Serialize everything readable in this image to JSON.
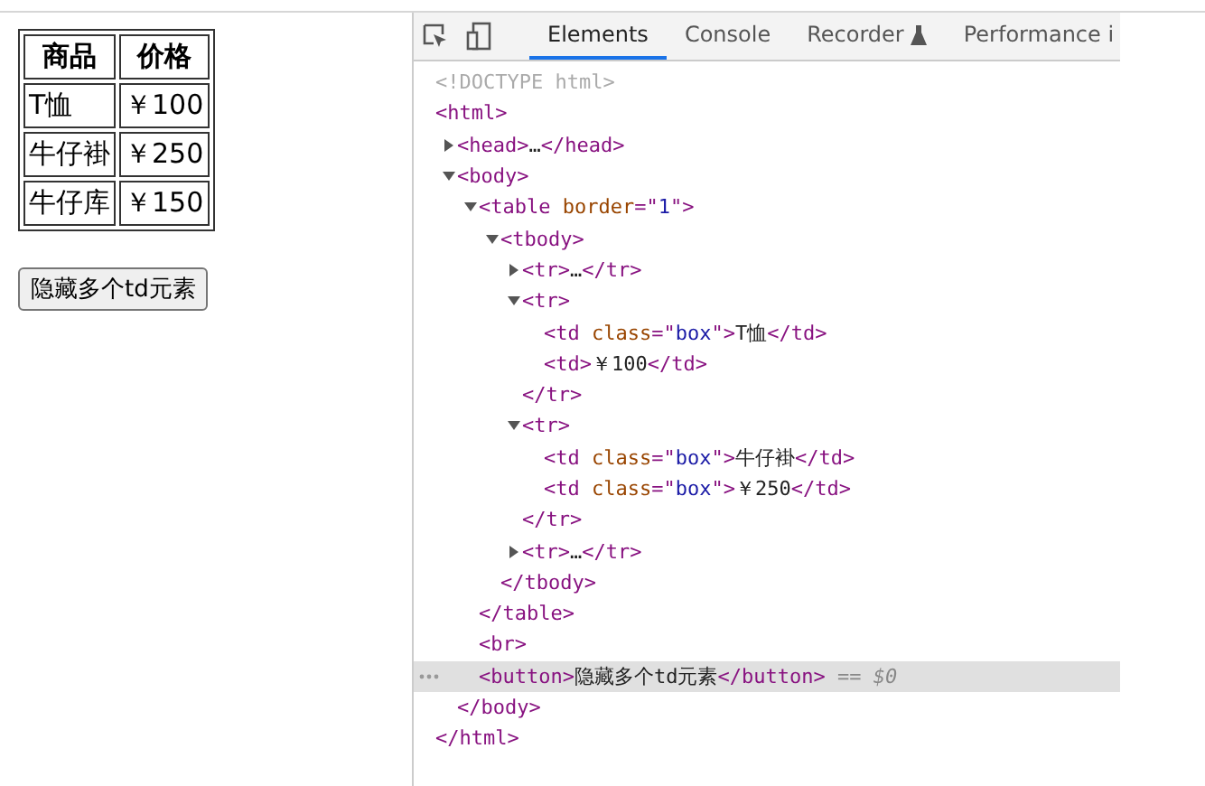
{
  "preview": {
    "table": {
      "columns": [
        "商品",
        "价格"
      ],
      "rows": [
        [
          "T恤",
          "￥100"
        ],
        [
          "牛仔褂",
          "￥250"
        ],
        [
          "牛仔库",
          "￥150"
        ]
      ]
    },
    "button": "隐藏多个td元素"
  },
  "devtools": {
    "tabs": [
      {
        "label": "Elements",
        "selected": true,
        "flask": false
      },
      {
        "label": "Console",
        "selected": false,
        "flask": false
      },
      {
        "label": "Recorder",
        "selected": false,
        "flask": true
      },
      {
        "label": "Performance i",
        "selected": false,
        "flask": false
      }
    ],
    "dom": [
      {
        "line": [
          {
            "kind": "doctype",
            "text": "<!DOCTYPE html>"
          }
        ]
      },
      {
        "line": [
          {
            "kind": "tag",
            "text": "<html>"
          }
        ],
        "close": [
          {
            "kind": "tag",
            "text": "</html>"
          }
        ],
        "children": [
          {
            "expanded": false,
            "line": [
              {
                "kind": "tag",
                "text": "<head>"
              },
              {
                "kind": "text",
                "text": "…"
              },
              {
                "kind": "tag",
                "text": "</head>"
              }
            ]
          },
          {
            "expanded": true,
            "line": [
              {
                "kind": "tag",
                "text": "<body>"
              }
            ],
            "close": [
              {
                "kind": "tag",
                "text": "</body>"
              }
            ],
            "children": [
              {
                "expanded": true,
                "line": [
                  {
                    "kind": "tag",
                    "text": "<table"
                  },
                  {
                    "kind": "attr",
                    "text": " border"
                  },
                  {
                    "kind": "tag",
                    "text": "=\""
                  },
                  {
                    "kind": "value",
                    "text": "1"
                  },
                  {
                    "kind": "tag",
                    "text": "\">"
                  }
                ],
                "close": [
                  {
                    "kind": "tag",
                    "text": "</table>"
                  }
                ],
                "children": [
                  {
                    "expanded": true,
                    "line": [
                      {
                        "kind": "tag",
                        "text": "<tbody>"
                      }
                    ],
                    "close": [
                      {
                        "kind": "tag",
                        "text": "</tbody>"
                      }
                    ],
                    "children": [
                      {
                        "expanded": false,
                        "line": [
                          {
                            "kind": "tag",
                            "text": "<tr>"
                          },
                          {
                            "kind": "text",
                            "text": "…"
                          },
                          {
                            "kind": "tag",
                            "text": "</tr>"
                          }
                        ]
                      },
                      {
                        "expanded": true,
                        "line": [
                          {
                            "kind": "tag",
                            "text": "<tr>"
                          }
                        ],
                        "close": [
                          {
                            "kind": "tag",
                            "text": "</tr>"
                          }
                        ],
                        "children": [
                          {
                            "line": [
                              {
                                "kind": "tag",
                                "text": "<td"
                              },
                              {
                                "kind": "attr",
                                "text": " class"
                              },
                              {
                                "kind": "tag",
                                "text": "=\""
                              },
                              {
                                "kind": "value",
                                "text": "box"
                              },
                              {
                                "kind": "tag",
                                "text": "\">"
                              },
                              {
                                "kind": "text",
                                "text": "T恤"
                              },
                              {
                                "kind": "tag",
                                "text": "</td>"
                              }
                            ]
                          },
                          {
                            "line": [
                              {
                                "kind": "tag",
                                "text": "<td>"
                              },
                              {
                                "kind": "text",
                                "text": "￥100"
                              },
                              {
                                "kind": "tag",
                                "text": "</td>"
                              }
                            ]
                          }
                        ]
                      },
                      {
                        "expanded": true,
                        "line": [
                          {
                            "kind": "tag",
                            "text": "<tr>"
                          }
                        ],
                        "close": [
                          {
                            "kind": "tag",
                            "text": "</tr>"
                          }
                        ],
                        "children": [
                          {
                            "line": [
                              {
                                "kind": "tag",
                                "text": "<td"
                              },
                              {
                                "kind": "attr",
                                "text": " class"
                              },
                              {
                                "kind": "tag",
                                "text": "=\""
                              },
                              {
                                "kind": "value",
                                "text": "box"
                              },
                              {
                                "kind": "tag",
                                "text": "\">"
                              },
                              {
                                "kind": "text",
                                "text": "牛仔褂"
                              },
                              {
                                "kind": "tag",
                                "text": "</td>"
                              }
                            ]
                          },
                          {
                            "line": [
                              {
                                "kind": "tag",
                                "text": "<td"
                              },
                              {
                                "kind": "attr",
                                "text": " class"
                              },
                              {
                                "kind": "tag",
                                "text": "=\""
                              },
                              {
                                "kind": "value",
                                "text": "box"
                              },
                              {
                                "kind": "tag",
                                "text": "\">"
                              },
                              {
                                "kind": "text",
                                "text": "￥250"
                              },
                              {
                                "kind": "tag",
                                "text": "</td>"
                              }
                            ]
                          }
                        ]
                      },
                      {
                        "expanded": false,
                        "line": [
                          {
                            "kind": "tag",
                            "text": "<tr>"
                          },
                          {
                            "kind": "text",
                            "text": "…"
                          },
                          {
                            "kind": "tag",
                            "text": "</tr>"
                          }
                        ]
                      }
                    ]
                  }
                ]
              },
              {
                "line": [
                  {
                    "kind": "tag",
                    "text": "<br>"
                  }
                ]
              },
              {
                "selected": true,
                "line": [
                  {
                    "kind": "tag",
                    "text": "<button>"
                  },
                  {
                    "kind": "text",
                    "text": "隐藏多个td元素"
                  },
                  {
                    "kind": "tag",
                    "text": "</button>"
                  },
                  {
                    "kind": "ref",
                    "text": " == $0"
                  }
                ]
              }
            ]
          }
        ]
      }
    ]
  }
}
